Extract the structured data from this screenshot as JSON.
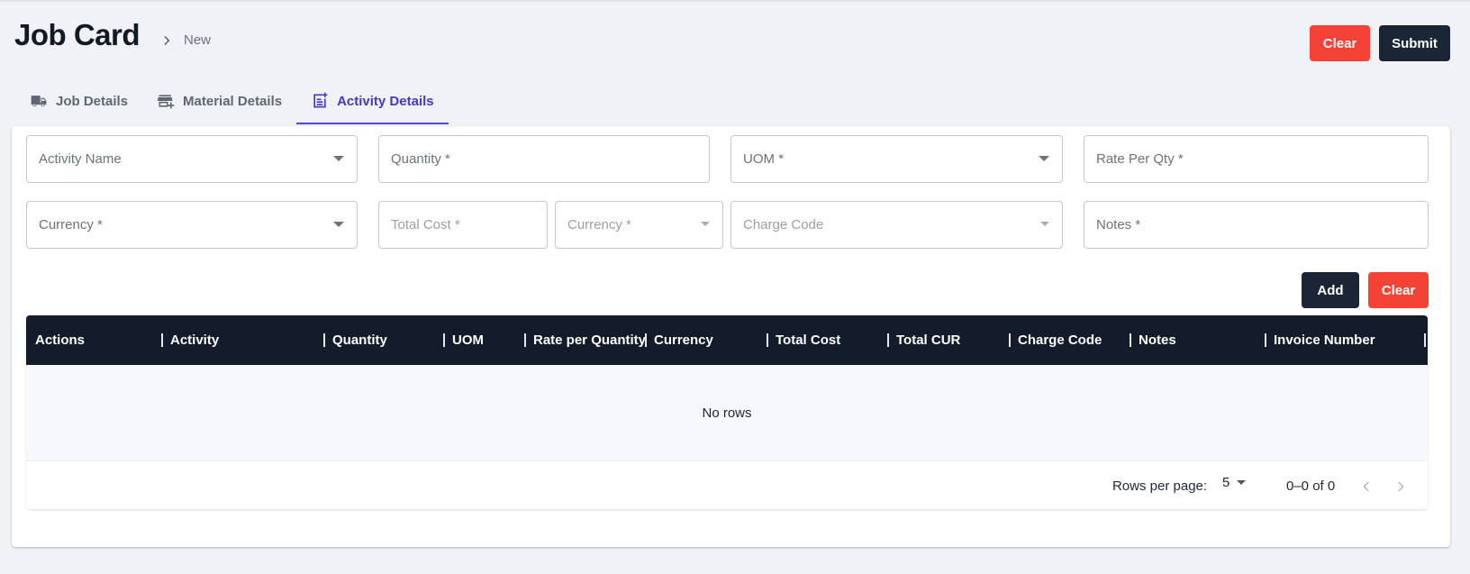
{
  "header": {
    "title": "Job Card",
    "breadcrumb": "New",
    "clear_label": "Clear",
    "submit_label": "Submit"
  },
  "tabs": [
    {
      "label": "Job Details",
      "icon": "truck-icon"
    },
    {
      "label": "Material Details",
      "icon": "store-add-icon"
    },
    {
      "label": "Activity Details",
      "icon": "note-add-icon"
    }
  ],
  "active_tab": "Activity Details",
  "form": {
    "activity_name": "Activity Name",
    "quantity": "Quantity *",
    "uom": "UOM *",
    "rate_per_qty": "Rate Per Qty *",
    "currency": "Currency *",
    "total_cost": "Total Cost *",
    "total_currency": "Currency *",
    "charge_code": "Charge Code",
    "notes": "Notes *",
    "add_label": "Add",
    "clear_label": "Clear"
  },
  "table": {
    "columns": [
      "Actions",
      "Activity",
      "Quantity",
      "UOM",
      "Rate per Quantity",
      "Currency",
      "Total Cost",
      "Total CUR",
      "Charge Code",
      "Notes",
      "Invoice Number"
    ],
    "rows": [],
    "empty_text": "No rows",
    "rows_per_page_label": "Rows per page:",
    "rows_per_page": "5",
    "range_text": "0–0 of 0"
  },
  "colors": {
    "accent": "#4338ca",
    "danger": "#f44336",
    "dark": "#1b2535",
    "table_header": "#141b2b"
  }
}
